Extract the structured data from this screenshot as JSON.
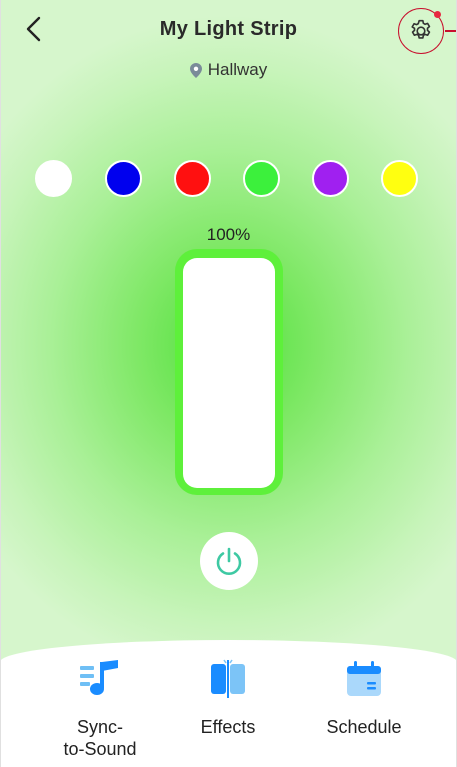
{
  "header": {
    "title": "My Light Strip",
    "location": "Hallway"
  },
  "swatches": [
    {
      "name": "white",
      "color": "#ffffff"
    },
    {
      "name": "blue",
      "color": "#0000ee"
    },
    {
      "name": "red",
      "color": "#ff1010"
    },
    {
      "name": "green",
      "color": "#3cf03c"
    },
    {
      "name": "purple",
      "color": "#a020f0"
    },
    {
      "name": "yellow",
      "color": "#ffff10"
    }
  ],
  "brightness": {
    "label": "100%",
    "value": 100
  },
  "colors": {
    "accent": "#1a8cff",
    "power_icon": "#3ec9a3",
    "highlight_ring": "#c8102e"
  },
  "tabs": [
    {
      "id": "sync",
      "label_line1": "Sync-",
      "label_line2": "to-Sound",
      "icon": "music-note-icon"
    },
    {
      "id": "effects",
      "label": "Effects",
      "icon": "effects-icon"
    },
    {
      "id": "schedule",
      "label": "Schedule",
      "icon": "calendar-icon"
    }
  ]
}
